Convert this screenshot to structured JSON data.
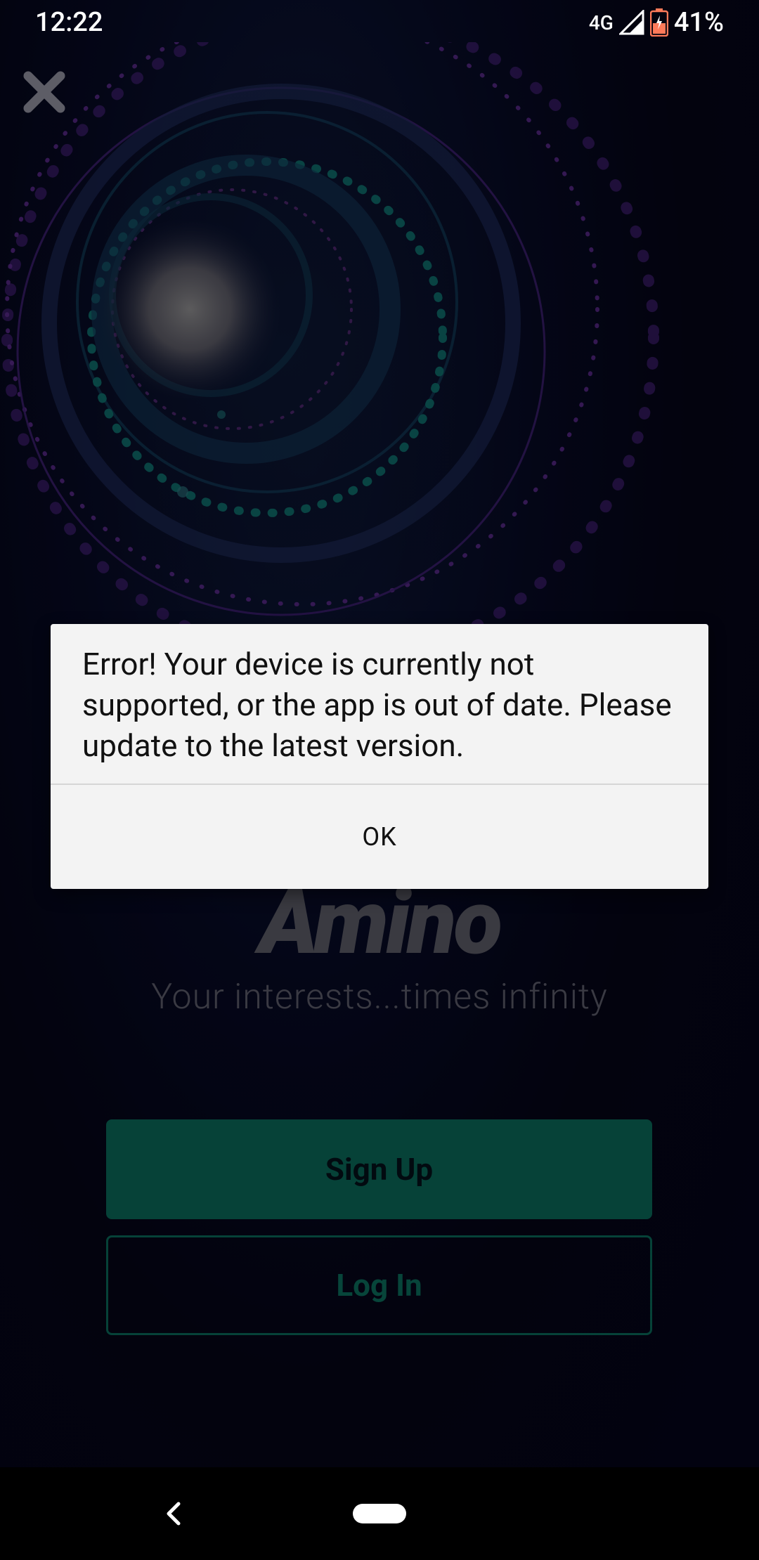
{
  "status_bar": {
    "time": "12:22",
    "network": "4G",
    "battery": "41%"
  },
  "background": {
    "close_icon": "close-icon",
    "logo_text": "Amino",
    "tagline": "Your interests...times infinity"
  },
  "auth": {
    "signup_label": "Sign Up",
    "login_label": "Log In"
  },
  "dialog": {
    "message": "Error! Your device is currently not supported, or the app is out of date. Please update to the latest version.",
    "ok_label": "OK"
  },
  "nav_bar": {
    "back_icon": "back-icon",
    "home_icon": "home-pill-icon"
  },
  "colors": {
    "accent": "#0a6656",
    "background": "#050516",
    "dialog_bg": "#f3f3f3"
  }
}
